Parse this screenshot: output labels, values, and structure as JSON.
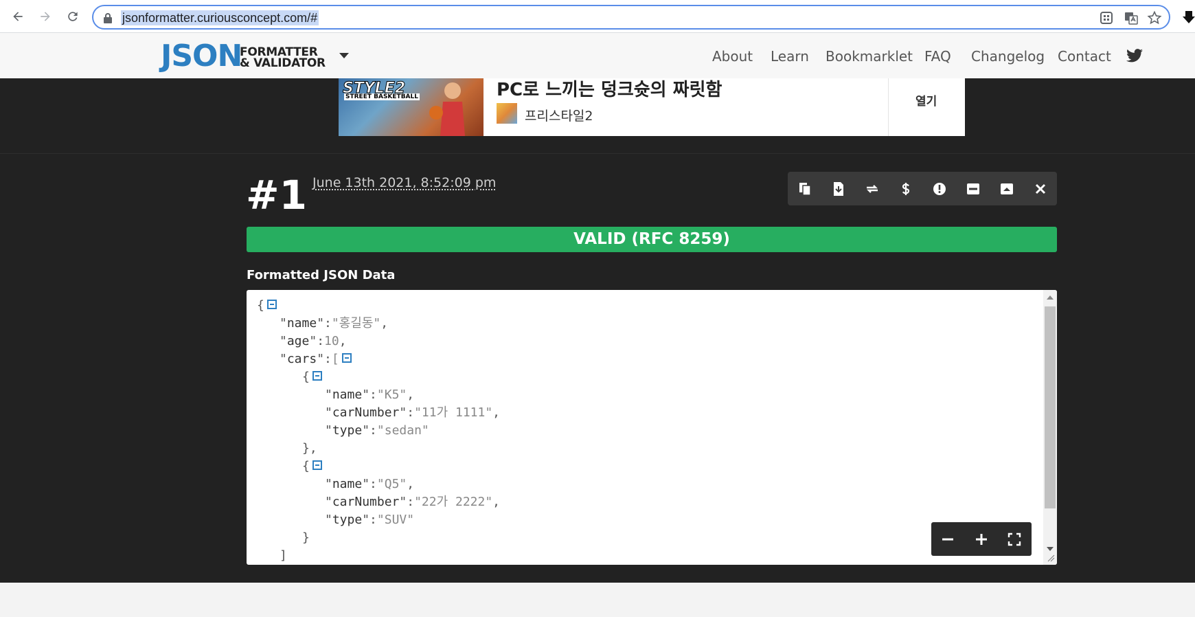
{
  "browser": {
    "url": "jsonformatter.curiousconcept.com/#"
  },
  "header": {
    "logo_json": "JSON",
    "logo_line1": "FORMATTER",
    "logo_line2": "& VALIDATOR",
    "nav": [
      "About",
      "Learn",
      "Bookmarklet",
      "FAQ",
      "Changelog",
      "Contact"
    ]
  },
  "ad": {
    "image_logo": "STYLE2",
    "image_sub": "STREET BASKETBALL",
    "title": "PC로 느끼는 덩크슛의 짜릿함",
    "brand": "프리스타일2",
    "cta": "열기"
  },
  "result": {
    "number": "#1",
    "timestamp": "June 13th 2021, 8:52:09 pm",
    "toolbar_icons": [
      "copy-icon",
      "download-icon",
      "refresh-icon",
      "dollar-icon",
      "alert-icon",
      "minimize-icon",
      "expand-up-icon",
      "close-icon"
    ],
    "status": "VALID (RFC 8259)",
    "section_title": "Formatted JSON Data"
  },
  "json_lines": [
    {
      "indent": 0,
      "text": "{",
      "collapse": true
    },
    {
      "indent": 1,
      "key": "name",
      "value": "\"홍길동\"",
      "suffix": ","
    },
    {
      "indent": 1,
      "key": "age",
      "value": "10",
      "suffix": ","
    },
    {
      "indent": 1,
      "key": "cars",
      "value": "[",
      "collapse": true
    },
    {
      "indent": 2,
      "text": "{",
      "collapse": true
    },
    {
      "indent": 3,
      "key": "name",
      "value": "\"K5\"",
      "suffix": ","
    },
    {
      "indent": 3,
      "key": "carNumber",
      "value": "\"11가 1111\"",
      "suffix": ","
    },
    {
      "indent": 3,
      "key": "type",
      "value": "\"sedan\""
    },
    {
      "indent": 2,
      "text": "},"
    },
    {
      "indent": 2,
      "text": "{",
      "collapse": true
    },
    {
      "indent": 3,
      "key": "name",
      "value": "\"Q5\"",
      "suffix": ","
    },
    {
      "indent": 3,
      "key": "carNumber",
      "value": "\"22가 2222\"",
      "suffix": ","
    },
    {
      "indent": 3,
      "key": "type",
      "value": "\"SUV\""
    },
    {
      "indent": 2,
      "text": "}"
    },
    {
      "indent": 1,
      "text": "]"
    }
  ],
  "zoom_controls": [
    "zoom-out-icon",
    "zoom-in-icon",
    "fullscreen-icon"
  ]
}
